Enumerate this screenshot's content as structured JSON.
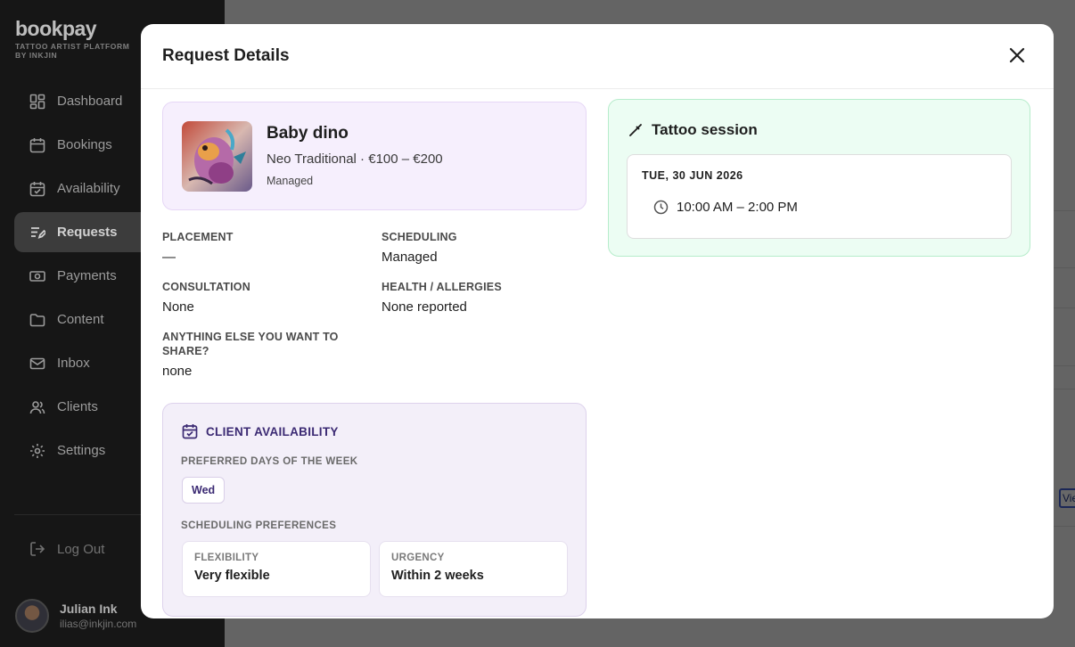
{
  "sidebar": {
    "brand": "bookpay",
    "brand_sub_1": "TATTOO ARTIST PLATFORM",
    "brand_sub_2": "BY INKJIN",
    "items": [
      {
        "label": "Dashboard",
        "icon": "dashboard-icon"
      },
      {
        "label": "Bookings",
        "icon": "calendar-icon"
      },
      {
        "label": "Availability",
        "icon": "calendar-check-icon"
      },
      {
        "label": "Requests",
        "icon": "requests-icon",
        "active": true
      },
      {
        "label": "Payments",
        "icon": "payments-icon"
      },
      {
        "label": "Content",
        "icon": "folder-icon"
      },
      {
        "label": "Inbox",
        "icon": "mail-icon"
      },
      {
        "label": "Clients",
        "icon": "users-icon"
      },
      {
        "label": "Settings",
        "icon": "gear-icon"
      }
    ],
    "logout": "Log Out",
    "user": {
      "name": "Julian Ink",
      "email": "ilias@inkjin.com"
    }
  },
  "background": {
    "view_button": "View"
  },
  "modal": {
    "title": "Request Details",
    "design": {
      "name": "Baby dino",
      "meta": "Neo Traditional · €100 – €200",
      "scheduling_tag": "Managed"
    },
    "fields": {
      "placement": {
        "label": "PLACEMENT",
        "value": "—"
      },
      "scheduling": {
        "label": "SCHEDULING",
        "value": "Managed"
      },
      "consultation": {
        "label": "CONSULTATION",
        "value": "None"
      },
      "health": {
        "label": "HEALTH / ALLERGIES",
        "value": "None reported"
      },
      "anything_else": {
        "label": "ANYTHING ELSE YOU WANT TO SHARE?",
        "value": "none"
      }
    },
    "availability": {
      "title": "CLIENT AVAILABILITY",
      "preferred_days_label": "PREFERRED DAYS OF THE WEEK",
      "days": [
        "Wed"
      ],
      "scheduling_prefs_label": "SCHEDULING PREFERENCES",
      "flexibility": {
        "label": "FLEXIBILITY",
        "value": "Very flexible"
      },
      "urgency": {
        "label": "URGENCY",
        "value": "Within 2 weeks"
      }
    },
    "session": {
      "title": "Tattoo session",
      "date": "TUE, 30 JUN 2026",
      "time": "10:00 AM – 2:00 PM"
    }
  },
  "colors": {
    "sidebar_bg": "#1c1c1c",
    "design_card_bg": "#f6effd",
    "availability_bg": "#f3eff9",
    "availability_accent": "#3b2a73",
    "session_bg": "#ecfdf3",
    "session_border": "#b6eccb"
  }
}
